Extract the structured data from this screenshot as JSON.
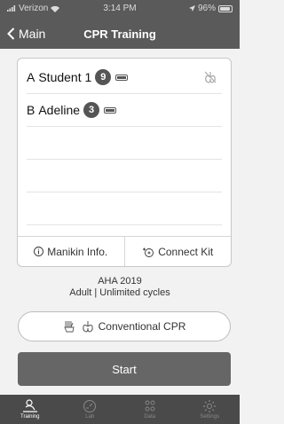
{
  "status_bar": {
    "carrier": "Verizon",
    "time": "3:14 PM",
    "battery": "96%"
  },
  "nav": {
    "back_label": "Main",
    "title": "CPR Training"
  },
  "students": [
    {
      "prefix": "A",
      "name": "Student 1",
      "count": "9"
    },
    {
      "prefix": "B",
      "name": "Adeline",
      "count": "3"
    }
  ],
  "card_footer": {
    "manikin_info": "Manikin Info.",
    "connect_kit": "Connect Kit"
  },
  "protocol": {
    "standard": "AHA 2019",
    "details": "Adult | Unlimited cycles"
  },
  "mode_button": {
    "label": "Conventional CPR"
  },
  "start_button": {
    "label": "Start"
  },
  "tabs": [
    {
      "label": "Training",
      "icon": "cpr-person-icon",
      "active": true
    },
    {
      "label": "Lab",
      "icon": "gauge-icon",
      "active": false
    },
    {
      "label": "Data",
      "icon": "people-icon",
      "active": false
    },
    {
      "label": "Settings",
      "icon": "gear-icon",
      "active": false
    }
  ],
  "colors": {
    "header": "#5a5a5a",
    "badge": "#555555",
    "start_button": "#666666",
    "tabbar": "#4a4a4a"
  }
}
